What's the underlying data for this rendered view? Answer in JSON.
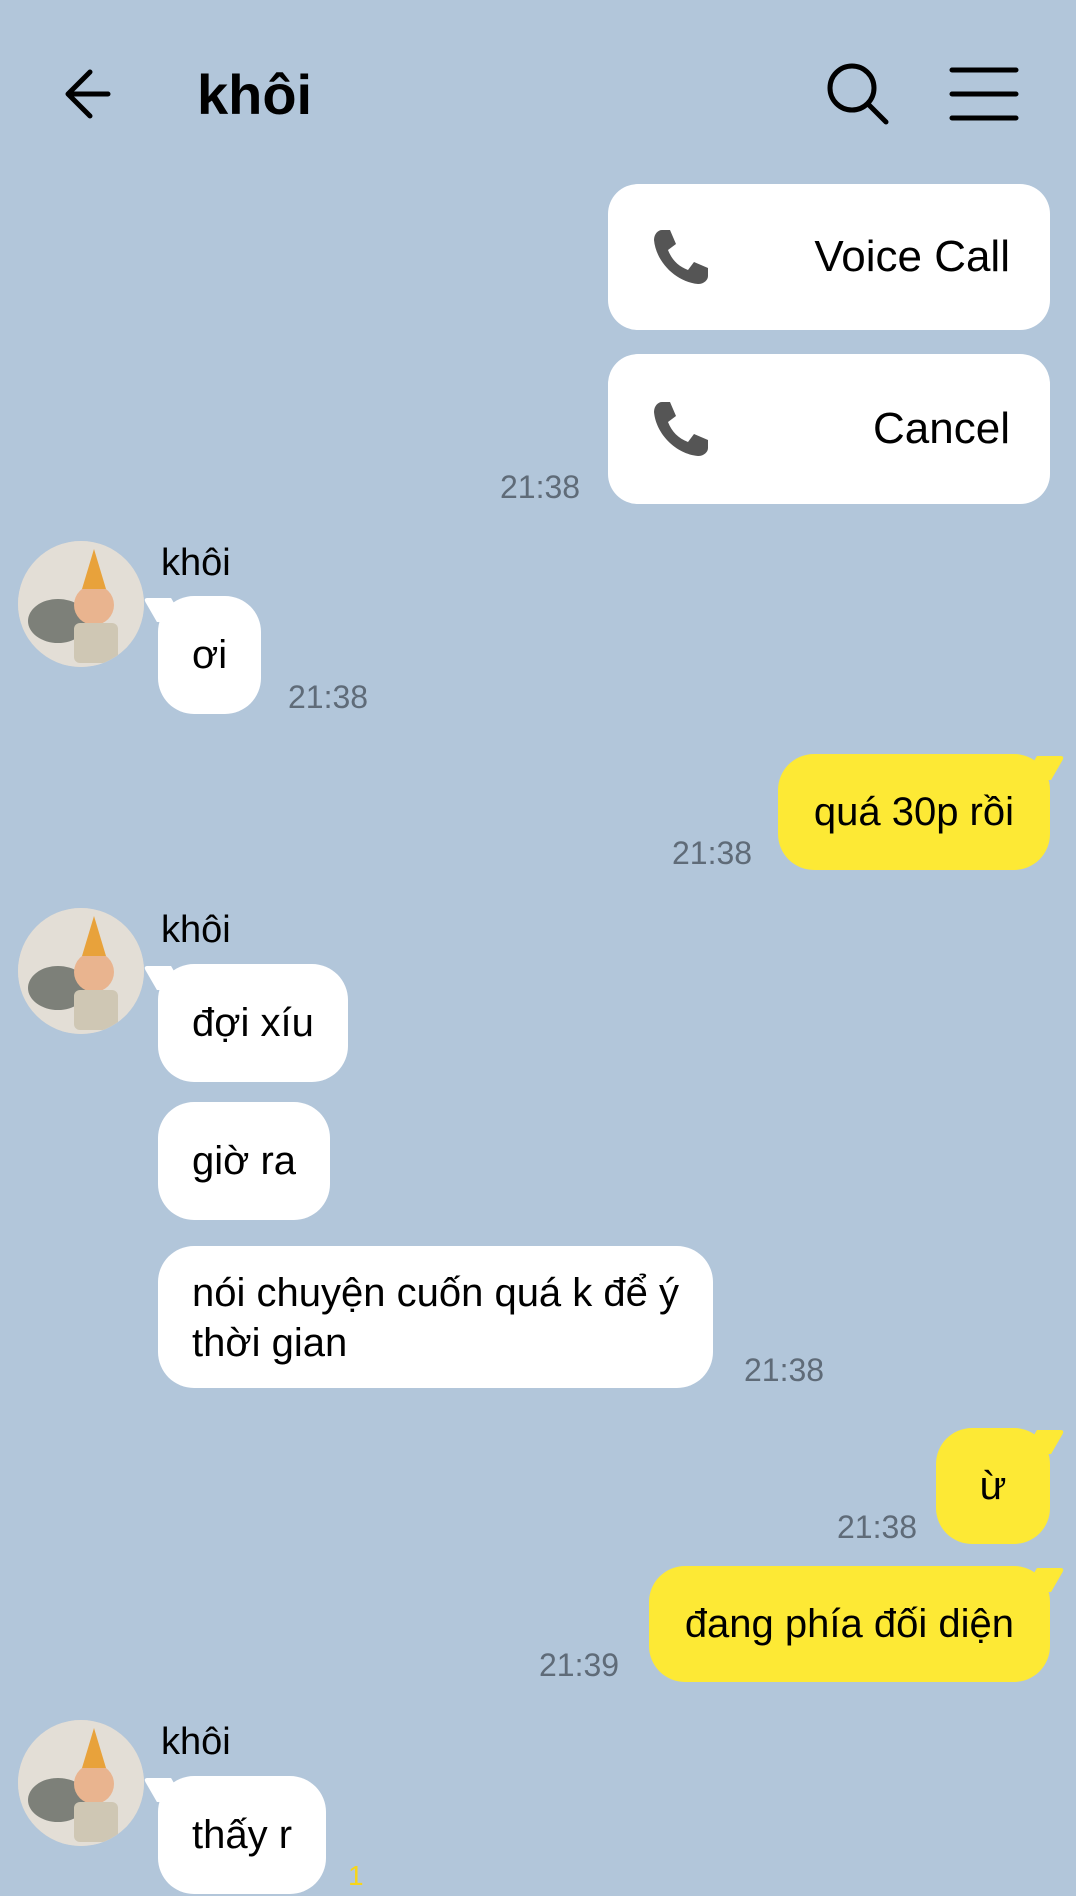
{
  "header": {
    "title": "khôi",
    "back_icon": "arrow-left-icon",
    "search_icon": "search-icon",
    "menu_icon": "hamburger-menu-icon"
  },
  "call_log": {
    "voice_call_label": "Voice Call",
    "cancel_label": "Cancel",
    "time": "21:38"
  },
  "messages": {
    "m1": {
      "sender": "khôi",
      "text": "ơi",
      "time": "21:38"
    },
    "m2": {
      "text": "quá 30p rồi",
      "time": "21:38"
    },
    "m3": {
      "sender": "khôi",
      "lines": [
        "đợi xíu",
        "giờ ra"
      ],
      "long_line1": "nói chuyện cuốn quá k để ý",
      "long_line2": "thời gian",
      "time": "21:38"
    },
    "m4": {
      "text": "ừ",
      "time": "21:38"
    },
    "m5": {
      "text": "đang phía đối diện",
      "time": "21:39"
    },
    "m6": {
      "sender": "khôi",
      "text": "thấy r",
      "unread": "1"
    }
  },
  "colors": {
    "background": "#b2c6da",
    "outgoing_bubble": "#fde935",
    "incoming_bubble": "#ffffff",
    "timestamp": "#5f6b78"
  }
}
